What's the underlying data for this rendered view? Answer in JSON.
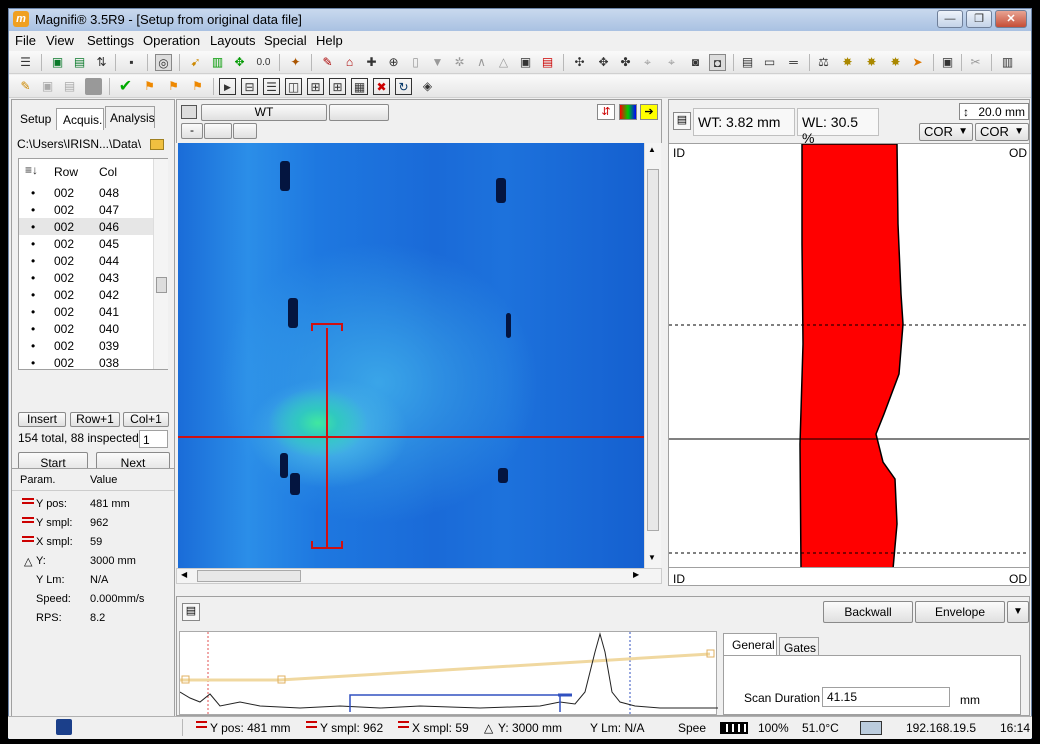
{
  "window": {
    "title": "Magnifi® 3.5R9 - [Setup from original data file]",
    "minimize": "—",
    "restore": "❐",
    "close": "✕",
    "icon_letter": "m"
  },
  "menu": [
    "File",
    "View",
    "Settings",
    "Operation",
    "Layouts",
    "Special",
    "Help"
  ],
  "left_tabs": [
    "Setup",
    "Acquis.",
    "Analysis"
  ],
  "path": "C:\\Users\\IRISN...\\Data\\",
  "list_headers": {
    "row": "Row",
    "col": "Col"
  },
  "list_rows": [
    {
      "row": "002",
      "col": "048"
    },
    {
      "row": "002",
      "col": "047"
    },
    {
      "row": "002",
      "col": "046"
    },
    {
      "row": "002",
      "col": "045"
    },
    {
      "row": "002",
      "col": "044"
    },
    {
      "row": "002",
      "col": "043"
    },
    {
      "row": "002",
      "col": "042"
    },
    {
      "row": "002",
      "col": "041"
    },
    {
      "row": "002",
      "col": "040"
    },
    {
      "row": "002",
      "col": "039"
    },
    {
      "row": "002",
      "col": "038"
    }
  ],
  "list_buttons": {
    "insert": "Insert",
    "row_plus": "Row+1",
    "col_plus": "Col+1"
  },
  "inspected_text": "154 total, 88 inspected",
  "inspected_input": "1",
  "start": "Start",
  "next": "Next",
  "param_headers": {
    "param": "Param.",
    "value": "Value"
  },
  "params": [
    {
      "name": "Y pos:",
      "value": "481 mm"
    },
    {
      "name": "Y smpl:",
      "value": "962"
    },
    {
      "name": "X smpl:",
      "value": "59"
    },
    {
      "name": "Y:",
      "value": "3000 mm"
    },
    {
      "name": "Y Lm:",
      "value": "N/A"
    },
    {
      "name": "Speed:",
      "value": "0.000mm/s"
    },
    {
      "name": "RPS:",
      "value": "8.2"
    }
  ],
  "cscan_header": {
    "button1": "WT",
    "button2": "",
    "minus": "-"
  },
  "ascan": {
    "wt": "WT: 3.82 mm",
    "wl": "WL: 30.5 %",
    "range": "20.0 mm",
    "cor1": "COR",
    "cor2": "COR",
    "id_top": "ID",
    "od_top": "OD",
    "id_bottom": "ID",
    "od_bottom": "OD"
  },
  "bottom_buttons": {
    "backwall": "Backwall",
    "envelope": "Envelope"
  },
  "bottom_tabs": [
    "General",
    "Gates"
  ],
  "scan_duration": {
    "label": "Scan Duration",
    "value": "41.15",
    "unit": "mm"
  },
  "status": {
    "ypos": "Y pos: 481 mm",
    "ysmpl": "Y smpl: 962",
    "xsmpl": "X smpl: 59",
    "dy": "Y: 3000 mm",
    "ylm": "Y Lm: N/A",
    "speed": "Spee",
    "battery": "100%",
    "temp": "51.0°C",
    "ip": "192.168.19.5",
    "time": "16:14"
  }
}
